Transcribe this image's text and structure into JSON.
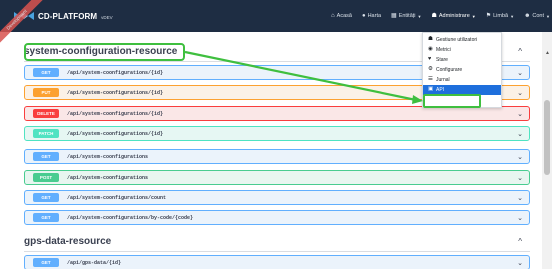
{
  "navbar": {
    "brand_name": "CD-PLATFORM",
    "brand_version": "vDEV",
    "items": [
      {
        "icon": "home-icon",
        "glyph": "⌂",
        "label": "Acasă",
        "caret": false
      },
      {
        "icon": "map-pin-icon",
        "glyph": "●",
        "label": "Harta",
        "caret": false
      },
      {
        "icon": "table-icon",
        "glyph": "▦",
        "label": "Entități",
        "caret": true
      },
      {
        "icon": "users-icon",
        "glyph": "☗",
        "label": "Administrare",
        "caret": true
      },
      {
        "icon": "flag-icon",
        "glyph": "⚑",
        "label": "Limbă",
        "caret": true
      },
      {
        "icon": "user-icon",
        "glyph": "☻",
        "label": "Cont",
        "caret": true
      }
    ]
  },
  "ribbon": {
    "text": "Development"
  },
  "admin_menu": {
    "items": [
      {
        "icon": "users-icon",
        "glyph": "☗",
        "label": "Gestiune utilizatori"
      },
      {
        "icon": "tachometer-icon",
        "glyph": "◉",
        "label": "Metrici"
      },
      {
        "icon": "heart-icon",
        "glyph": "♥",
        "label": "Stare"
      },
      {
        "icon": "cogs-icon",
        "glyph": "⚙",
        "label": "Configurare"
      },
      {
        "icon": "list-icon",
        "glyph": "☰",
        "label": "Jurnal"
      },
      {
        "icon": "book-icon",
        "glyph": "▣",
        "label": "API"
      }
    ],
    "selected_index": 5
  },
  "sections": [
    {
      "title": "system-coonfiguration-resource",
      "chevron": "^",
      "operations": [
        {
          "method": "GET",
          "path": "/api/system-coonfigurations/{id}"
        },
        {
          "method": "PUT",
          "path": "/api/system-coonfigurations/{id}"
        },
        {
          "method": "DELETE",
          "path": "/api/system-coonfigurations/{id}"
        },
        {
          "method": "PATCH",
          "path": "/api/system-coonfigurations/{id}"
        },
        {
          "method": "GET",
          "path": "/api/system-coonfigurations"
        },
        {
          "method": "POST",
          "path": "/api/system-coonfigurations"
        },
        {
          "method": "GET",
          "path": "/api/system-coonfigurations/count"
        },
        {
          "method": "GET",
          "path": "/api/system-coonfigurations/by-code/{code}"
        }
      ]
    },
    {
      "title": "gps-data-resource",
      "chevron": "^",
      "operations": [
        {
          "method": "GET",
          "path": "/api/gps-data/{id}"
        }
      ]
    }
  ],
  "colors": {
    "navbar": "#1e2d43",
    "get": "#61affe",
    "put": "#fca130",
    "delete": "#f93e3e",
    "patch": "#50e3c2",
    "post": "#49cc90",
    "highlight": "#3fbf3f",
    "menu_selected": "#1e6fdc"
  }
}
